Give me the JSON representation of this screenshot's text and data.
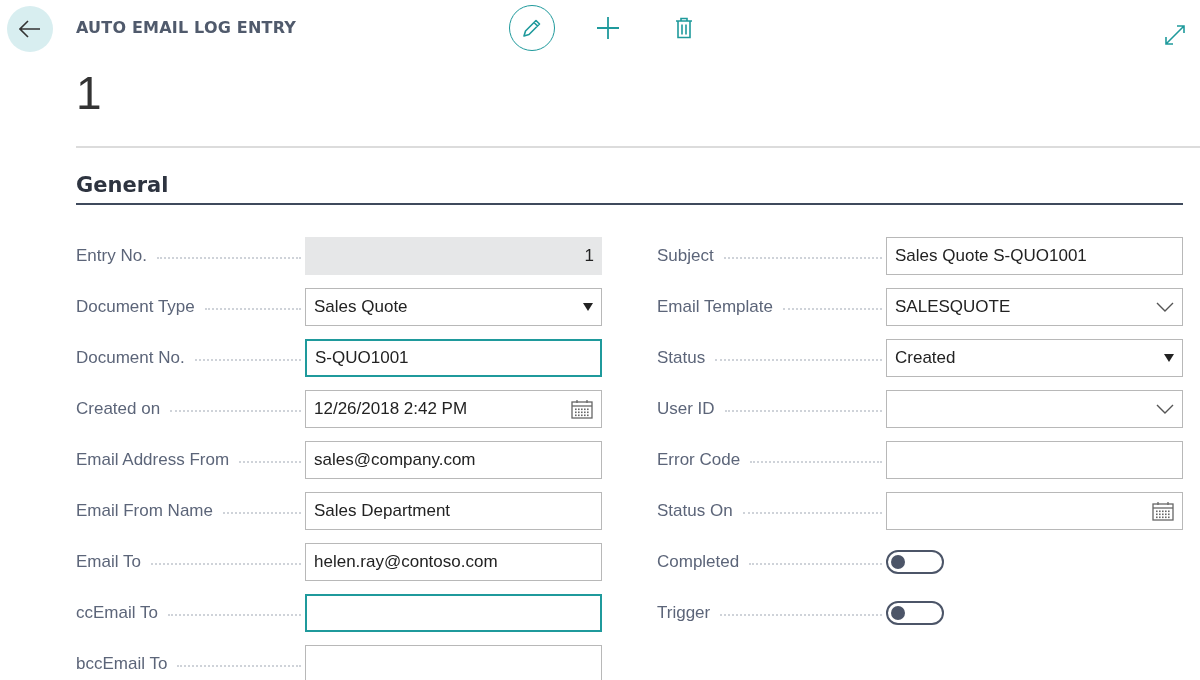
{
  "header": {
    "title": "AUTO EMAIL LOG ENTRY",
    "record": "1"
  },
  "section": {
    "title": "General"
  },
  "left_fields": [
    {
      "label": "Entry No.",
      "kind": "readonly",
      "value": "1",
      "focused": false
    },
    {
      "label": "Document Type",
      "kind": "select",
      "value": "Sales Quote",
      "focused": false
    },
    {
      "label": "Document No.",
      "kind": "text",
      "value": "S-QUO1001",
      "focused": true
    },
    {
      "label": "Created on",
      "kind": "date",
      "value": "12/26/2018 2:42 PM",
      "focused": false
    },
    {
      "label": "Email Address From",
      "kind": "text",
      "value": "sales@company.com",
      "focused": false
    },
    {
      "label": "Email From Name",
      "kind": "text",
      "value": "Sales Department",
      "focused": false
    },
    {
      "label": "Email To",
      "kind": "text",
      "value": "helen.ray@contoso.com",
      "focused": false
    },
    {
      "label": "ccEmail To",
      "kind": "text",
      "focused": true
    },
    {
      "label": "bccEmail To",
      "kind": "text",
      "focused": false
    }
  ],
  "right_fields": [
    {
      "label": "Subject",
      "kind": "text",
      "value": "Sales Quote S-QUO1001",
      "focused": false
    },
    {
      "label": "Email Template",
      "kind": "lookup",
      "value": "SALESQUOTE",
      "focused": false
    },
    {
      "label": "Status",
      "kind": "select",
      "value": "Created",
      "focused": false
    },
    {
      "label": "User ID",
      "kind": "lookup",
      "focused": false
    },
    {
      "label": "Error Code",
      "kind": "text",
      "focused": false
    },
    {
      "label": "Status On",
      "kind": "date",
      "focused": false
    },
    {
      "label": "Completed",
      "kind": "toggle",
      "on": false
    },
    {
      "label": "Trigger",
      "kind": "toggle",
      "on": false
    }
  ]
}
